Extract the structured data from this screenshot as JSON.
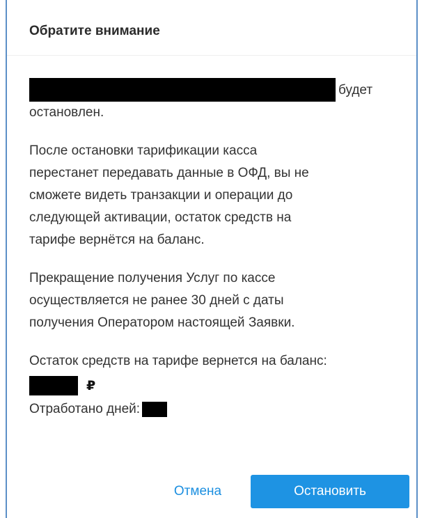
{
  "dialog": {
    "title": "Обратите внимание",
    "first_para_suffix": "будет",
    "first_para_line2": "остановлен.",
    "para2_lines": [
      "После остановки тарификации касса",
      "перестанет передавать данные в ОФД, вы не",
      "сможете видеть транзакции и операции до",
      "следующей активации, остаток средств на",
      "тарифе вернётся на баланс."
    ],
    "para3_lines": [
      "Прекращение получения Услуг по кассе",
      "осуществляется не ранее 30 дней с даты",
      "получения Оператором настоящей Заявки."
    ],
    "balance_label": "Остаток средств на тарифе вернется на баланс:",
    "currency_symbol": "₽",
    "days_label": "Отработано дней:",
    "cancel_label": "Отмена",
    "stop_label": "Остановить"
  },
  "colors": {
    "accent": "#1e93e3",
    "link": "#1c8fe0",
    "border": "#5b8fc7",
    "redaction": "#000000"
  }
}
